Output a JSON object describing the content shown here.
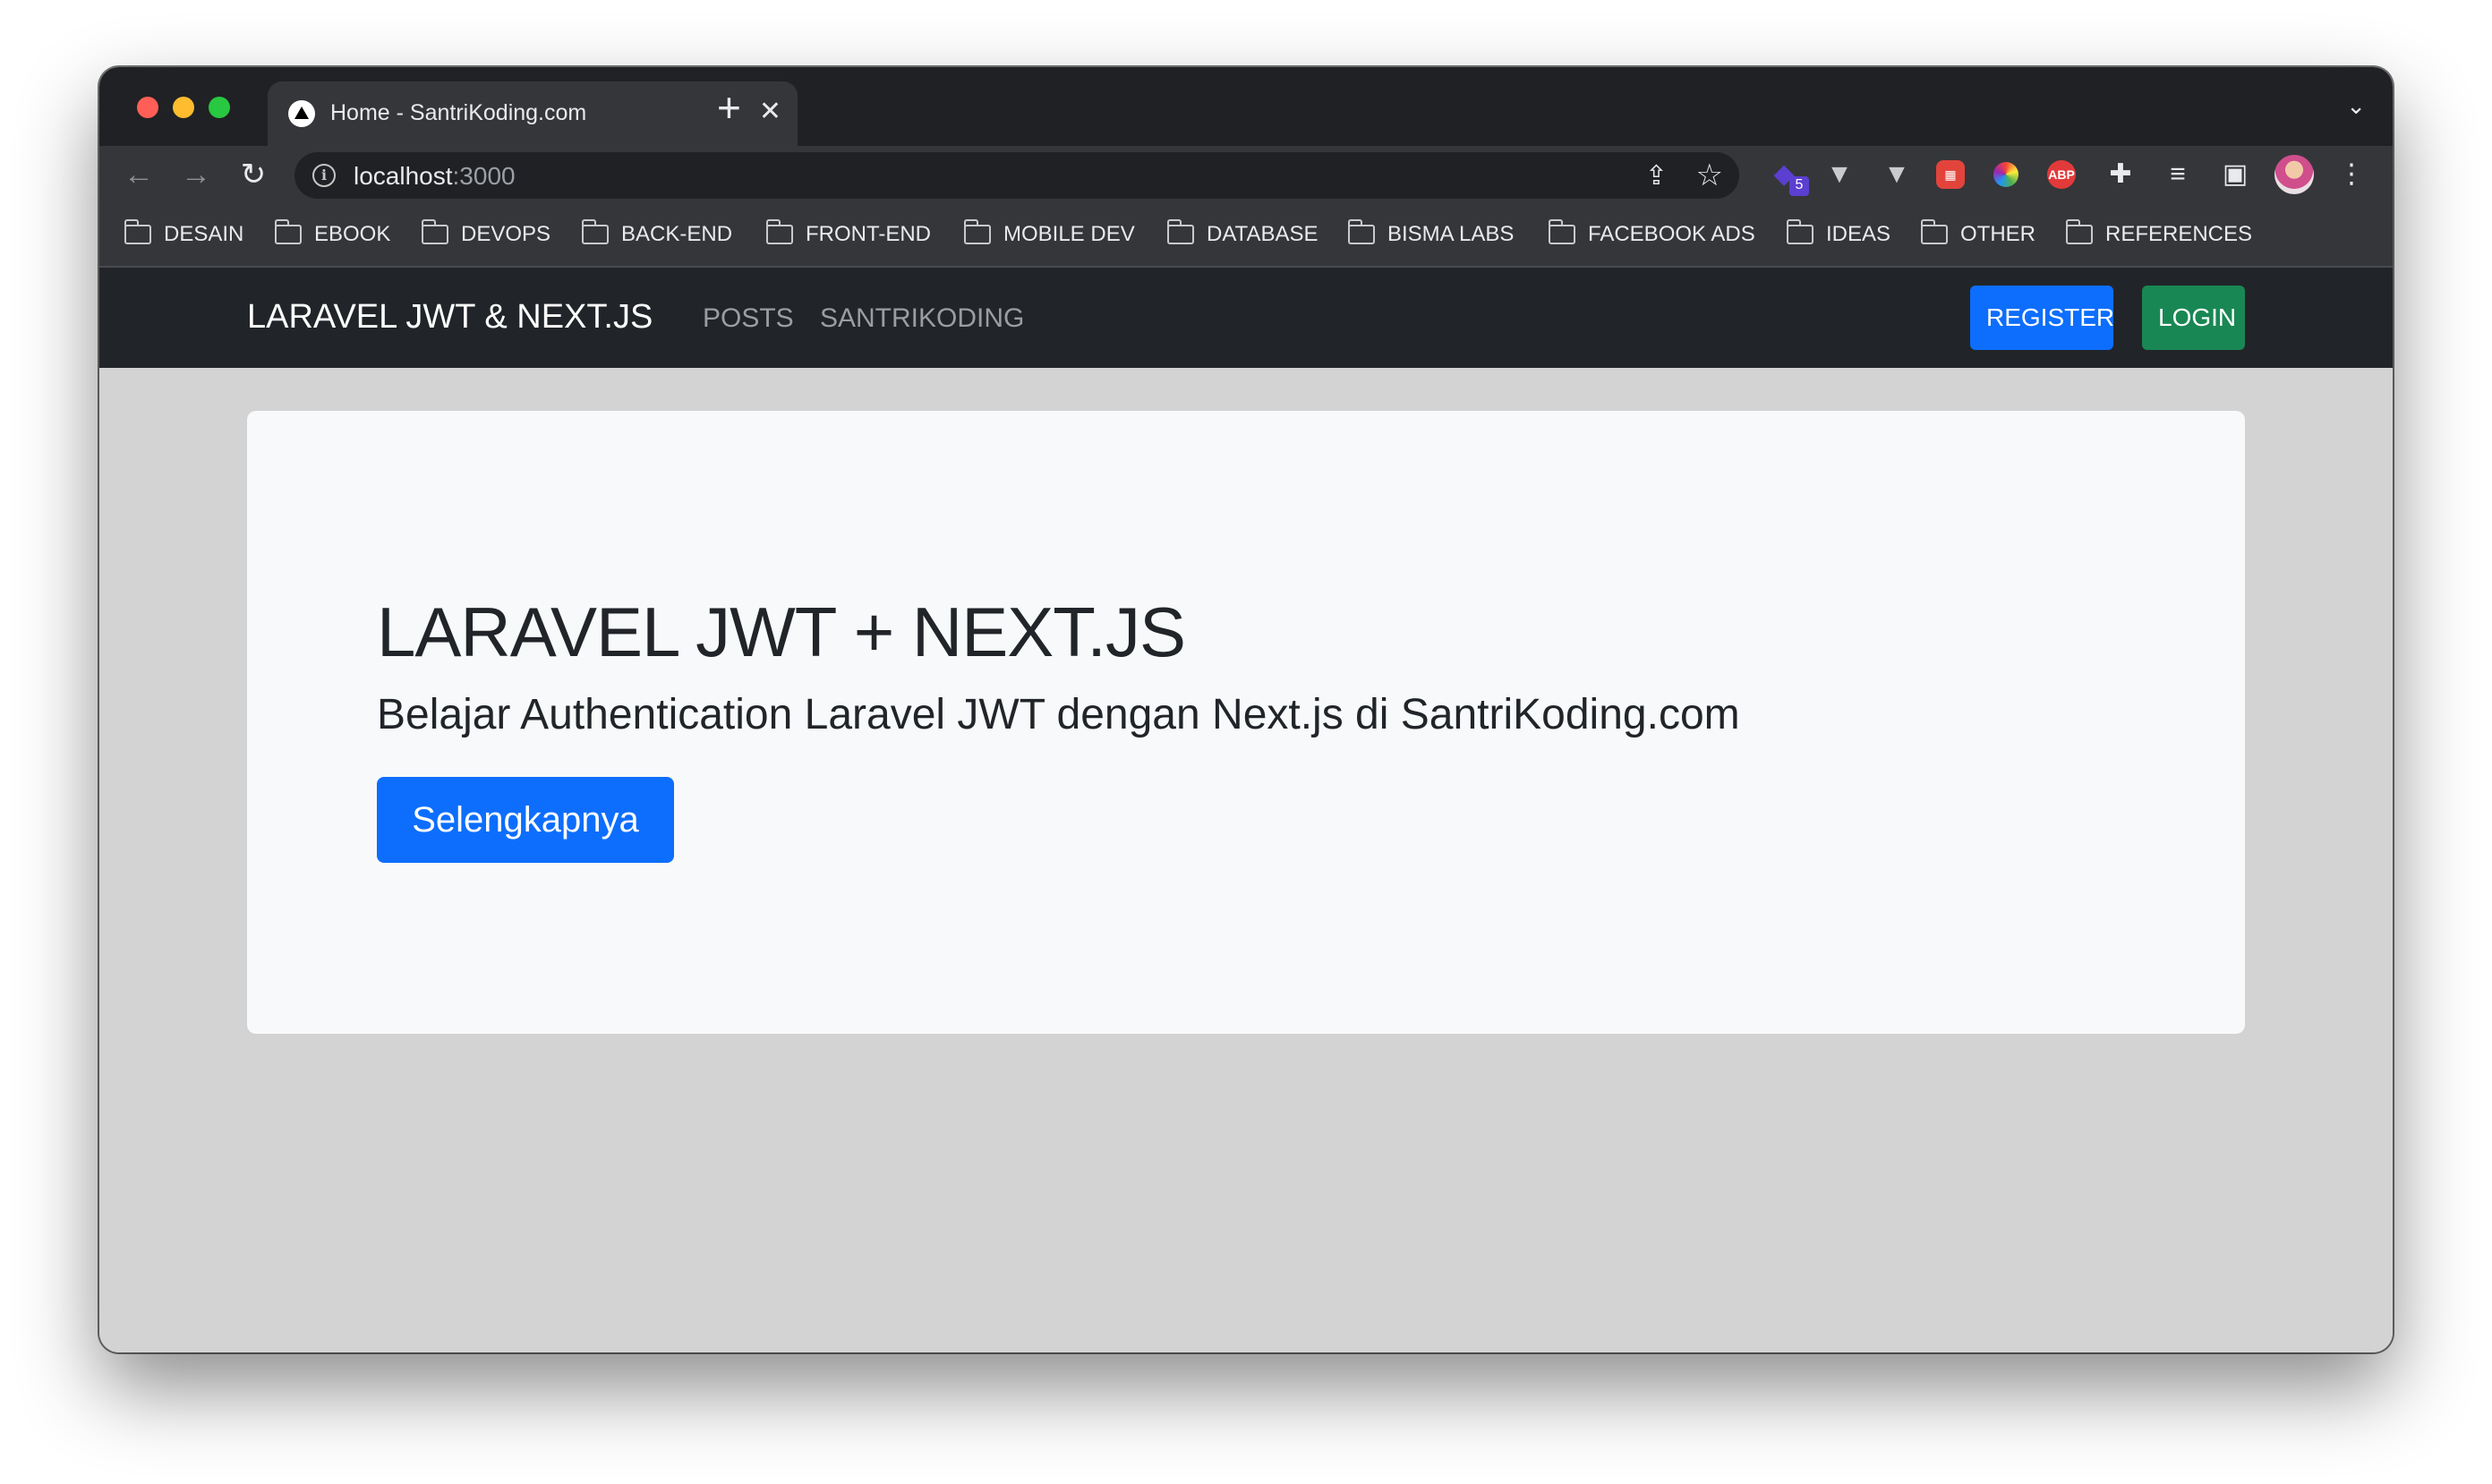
{
  "browser": {
    "tab_title": "Home - SantriKoding.com",
    "url_host": "localhost",
    "url_port": ":3000",
    "extensions_badge": "5",
    "abp_label": "ABP",
    "bookmarks": [
      "DESAIN",
      "EBOOK",
      "DEVOPS",
      "BACK-END",
      "FRONT-END",
      "MOBILE DEV",
      "DATABASE",
      "BISMA LABS",
      "FACEBOOK ADS",
      "IDEAS",
      "OTHER",
      "REFERENCES"
    ]
  },
  "navbar": {
    "brand": "LARAVEL JWT & NEXT.JS",
    "links": [
      "POSTS",
      "SANTRIKODING"
    ],
    "register_label": "REGISTER",
    "login_label": "LOGIN"
  },
  "hero": {
    "title": "LARAVEL JWT + NEXT.JS",
    "subtitle": "Belajar Authentication Laravel JWT dengan Next.js di SantriKoding.com",
    "button_label": "Selengkapnya"
  },
  "colors": {
    "primary": "#0d6efd",
    "success": "#198754",
    "navbar_bg": "#212529",
    "page_bg": "#d3d3d3",
    "card_bg": "#f8f9fa"
  }
}
